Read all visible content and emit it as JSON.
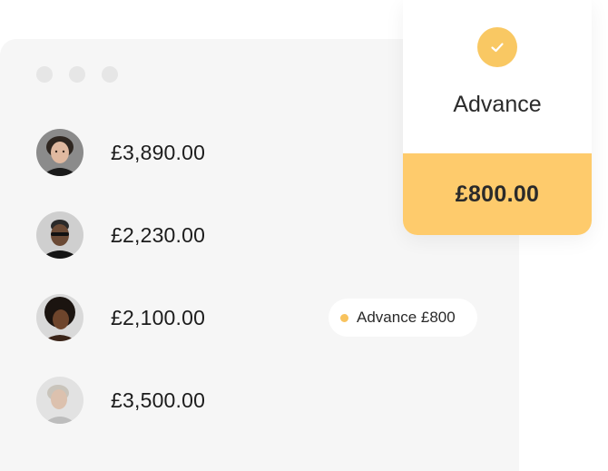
{
  "payments": [
    {
      "amount": "£3,890.00",
      "avatar": "person-1"
    },
    {
      "amount": "£2,230.00",
      "avatar": "person-2"
    },
    {
      "amount": "£2,100.00",
      "avatar": "person-3"
    },
    {
      "amount": "£3,500.00",
      "avatar": "person-4"
    }
  ],
  "advance_badge": {
    "label": "Advance £800"
  },
  "advance_card": {
    "title": "Advance",
    "amount": "£800.00",
    "icon": "check-icon"
  },
  "colors": {
    "accent": "#fecb6c",
    "window_bg": "#f6f6f6"
  }
}
